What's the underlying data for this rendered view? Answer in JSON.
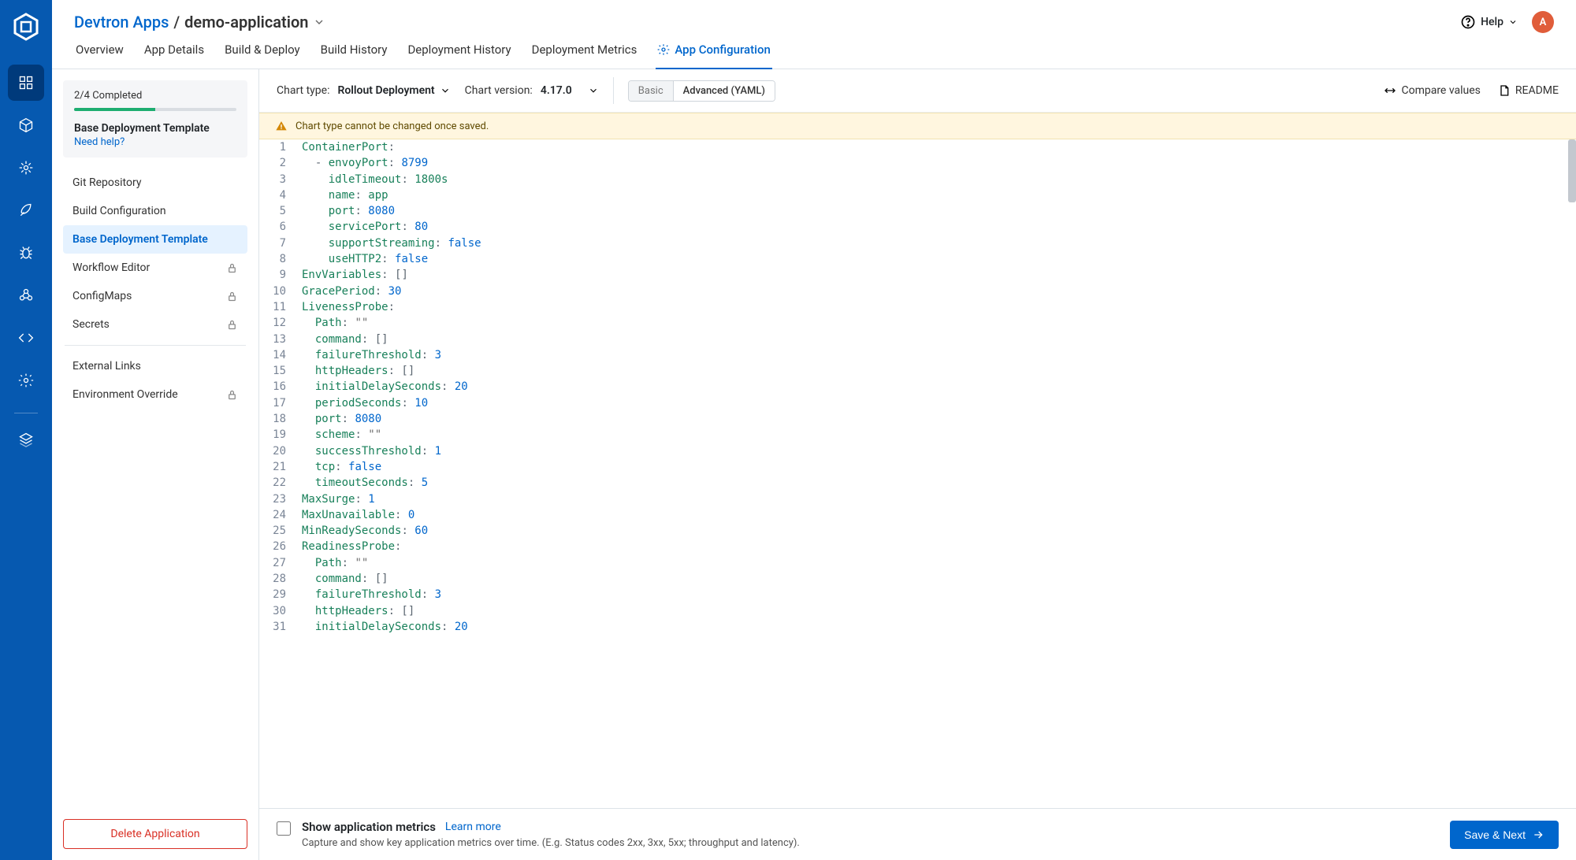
{
  "breadcrumb": {
    "root": "Devtron Apps",
    "sep": "/",
    "current": "demo-application"
  },
  "header": {
    "help": "Help",
    "avatar_initial": "A"
  },
  "tabs": [
    {
      "label": "Overview",
      "active": false
    },
    {
      "label": "App Details",
      "active": false
    },
    {
      "label": "Build & Deploy",
      "active": false
    },
    {
      "label": "Build History",
      "active": false
    },
    {
      "label": "Deployment History",
      "active": false
    },
    {
      "label": "Deployment Metrics",
      "active": false
    },
    {
      "label": "App Configuration",
      "active": true,
      "icon": "gear"
    }
  ],
  "progress": {
    "label": "2/4 Completed",
    "title": "Base Deployment Template",
    "help": "Need help?",
    "percent": 50
  },
  "nav": [
    {
      "label": "Git Repository"
    },
    {
      "label": "Build Configuration"
    },
    {
      "label": "Base Deployment Template",
      "active": true
    },
    {
      "label": "Workflow Editor",
      "locked": true
    },
    {
      "label": "ConfigMaps",
      "locked": true
    },
    {
      "label": "Secrets",
      "locked": true
    },
    {
      "sep": true
    },
    {
      "label": "External Links"
    },
    {
      "label": "Environment Override",
      "locked": true
    }
  ],
  "delete_label": "Delete Application",
  "toolbar": {
    "chart_type_label": "Chart type:",
    "chart_type_value": "Rollout Deployment",
    "chart_version_label": "Chart version:",
    "chart_version_value": "4.17.0",
    "toggle_basic": "Basic",
    "toggle_advanced": "Advanced (YAML)",
    "compare": "Compare values",
    "readme": "README"
  },
  "warning": "Chart type cannot be changed once saved.",
  "code_lines": [
    [
      {
        "k": "ContainerPort"
      },
      {
        "p": ":"
      }
    ],
    [
      {
        "i": 1
      },
      {
        "p": "- "
      },
      {
        "k": "envoyPort"
      },
      {
        "p": ": "
      },
      {
        "n": "8799"
      }
    ],
    [
      {
        "i": 2
      },
      {
        "k": "idleTimeout"
      },
      {
        "p": ": "
      },
      {
        "pl": "1800s"
      }
    ],
    [
      {
        "i": 2
      },
      {
        "k": "name"
      },
      {
        "p": ": "
      },
      {
        "pl": "app"
      }
    ],
    [
      {
        "i": 2
      },
      {
        "k": "port"
      },
      {
        "p": ": "
      },
      {
        "n": "8080"
      }
    ],
    [
      {
        "i": 2
      },
      {
        "k": "servicePort"
      },
      {
        "p": ": "
      },
      {
        "n": "80"
      }
    ],
    [
      {
        "i": 2
      },
      {
        "k": "supportStreaming"
      },
      {
        "p": ": "
      },
      {
        "b": "false"
      }
    ],
    [
      {
        "i": 2
      },
      {
        "k": "useHTTP2"
      },
      {
        "p": ": "
      },
      {
        "b": "false"
      }
    ],
    [
      {
        "k": "EnvVariables"
      },
      {
        "p": ": []"
      }
    ],
    [
      {
        "k": "GracePeriod"
      },
      {
        "p": ": "
      },
      {
        "n": "30"
      }
    ],
    [
      {
        "k": "LivenessProbe"
      },
      {
        "p": ":"
      }
    ],
    [
      {
        "i": 1
      },
      {
        "k": "Path"
      },
      {
        "p": ": "
      },
      {
        "s": "\"\""
      }
    ],
    [
      {
        "i": 1
      },
      {
        "k": "command"
      },
      {
        "p": ": []"
      }
    ],
    [
      {
        "i": 1
      },
      {
        "k": "failureThreshold"
      },
      {
        "p": ": "
      },
      {
        "n": "3"
      }
    ],
    [
      {
        "i": 1
      },
      {
        "k": "httpHeaders"
      },
      {
        "p": ": []"
      }
    ],
    [
      {
        "i": 1
      },
      {
        "k": "initialDelaySeconds"
      },
      {
        "p": ": "
      },
      {
        "n": "20"
      }
    ],
    [
      {
        "i": 1
      },
      {
        "k": "periodSeconds"
      },
      {
        "p": ": "
      },
      {
        "n": "10"
      }
    ],
    [
      {
        "i": 1
      },
      {
        "k": "port"
      },
      {
        "p": ": "
      },
      {
        "n": "8080"
      }
    ],
    [
      {
        "i": 1
      },
      {
        "k": "scheme"
      },
      {
        "p": ": "
      },
      {
        "s": "\"\""
      }
    ],
    [
      {
        "i": 1
      },
      {
        "k": "successThreshold"
      },
      {
        "p": ": "
      },
      {
        "n": "1"
      }
    ],
    [
      {
        "i": 1
      },
      {
        "k": "tcp"
      },
      {
        "p": ": "
      },
      {
        "b": "false"
      }
    ],
    [
      {
        "i": 1
      },
      {
        "k": "timeoutSeconds"
      },
      {
        "p": ": "
      },
      {
        "n": "5"
      }
    ],
    [
      {
        "k": "MaxSurge"
      },
      {
        "p": ": "
      },
      {
        "n": "1"
      }
    ],
    [
      {
        "k": "MaxUnavailable"
      },
      {
        "p": ": "
      },
      {
        "n": "0"
      }
    ],
    [
      {
        "k": "MinReadySeconds"
      },
      {
        "p": ": "
      },
      {
        "n": "60"
      }
    ],
    [
      {
        "k": "ReadinessProbe"
      },
      {
        "p": ":"
      }
    ],
    [
      {
        "i": 1
      },
      {
        "k": "Path"
      },
      {
        "p": ": "
      },
      {
        "s": "\"\""
      }
    ],
    [
      {
        "i": 1
      },
      {
        "k": "command"
      },
      {
        "p": ": []"
      }
    ],
    [
      {
        "i": 1
      },
      {
        "k": "failureThreshold"
      },
      {
        "p": ": "
      },
      {
        "n": "3"
      }
    ],
    [
      {
        "i": 1
      },
      {
        "k": "httpHeaders"
      },
      {
        "p": ": []"
      }
    ],
    [
      {
        "i": 1
      },
      {
        "k": "initialDelaySeconds"
      },
      {
        "p": ": "
      },
      {
        "n": "20"
      }
    ]
  ],
  "footer": {
    "title": "Show application metrics",
    "learn": "Learn more",
    "desc": "Capture and show key application metrics over time. (E.g. Status codes 2xx, 3xx, 5xx; throughput and latency).",
    "save": "Save & Next"
  }
}
